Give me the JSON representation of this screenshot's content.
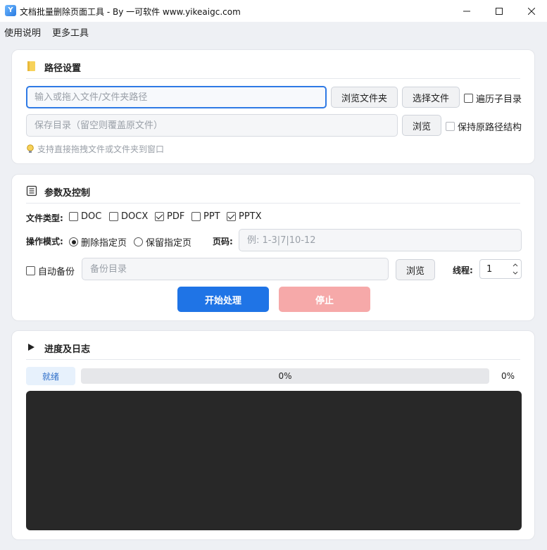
{
  "window": {
    "title": "文档批量删除页面工具 - By 一可软件 www.yikeaigc.com",
    "icon": "app-logo-icon"
  },
  "menu": [
    "使用说明",
    "更多工具"
  ],
  "path_section": {
    "title": "路径设置",
    "icon": "folder-icon",
    "input_placeholder": "输入或拖入文件/文件夹路径",
    "input_value": "",
    "browse_folder_label": "浏览文件夹",
    "select_file_label": "选择文件",
    "traverse_subdirs_label": "遍历子目录",
    "traverse_subdirs_checked": false,
    "save_dir_placeholder": "保存目录（留空则覆盖原文件）",
    "save_dir_value": "",
    "browse_label": "浏览",
    "keep_structure_label": "保持原路径结构",
    "keep_structure_checked": false,
    "hint": "支持直接拖拽文件或文件夹到窗口",
    "hint_icon": "lightbulb-icon"
  },
  "params_section": {
    "title": "参数及控制",
    "icon": "list-document-icon",
    "file_type_label": "文件类型:",
    "file_types": [
      {
        "label": "DOC",
        "checked": false
      },
      {
        "label": "DOCX",
        "checked": false
      },
      {
        "label": "PDF",
        "checked": true
      },
      {
        "label": "PPT",
        "checked": false
      },
      {
        "label": "PPTX",
        "checked": true
      }
    ],
    "mode_label": "操作模式:",
    "modes": [
      {
        "label": "删除指定页",
        "selected": true
      },
      {
        "label": "保留指定页",
        "selected": false
      }
    ],
    "pages_label": "页码:",
    "pages_placeholder": "例: 1-3|7|10-12",
    "pages_value": "",
    "auto_backup_label": "自动备份",
    "auto_backup_checked": false,
    "backup_placeholder": "备份目录",
    "backup_browse_label": "浏览",
    "threads_label": "线程:",
    "threads_value": "1",
    "start_label": "开始处理",
    "stop_label": "停止",
    "start_color": "#1f74e6",
    "stop_color": "#f6a9a9"
  },
  "progress_section": {
    "title": "进度及日志",
    "icon": "play-triangle-icon",
    "status": "就绪",
    "progress_percent": 0,
    "progress_text": "0%",
    "progress_right_text": "0%",
    "log_text": ""
  }
}
